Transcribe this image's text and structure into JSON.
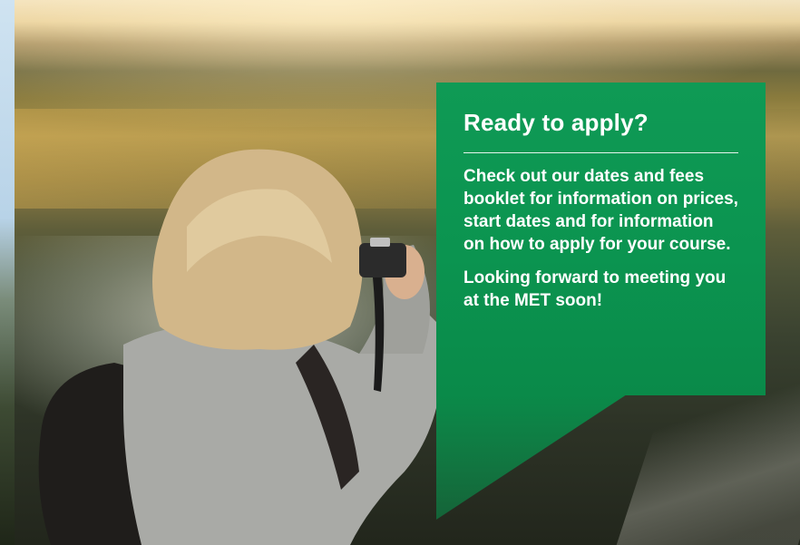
{
  "panel": {
    "title": "Ready to apply?",
    "body": "Check out our dates and fees booklet for information on prices, start dates and for information on how to apply for your course.",
    "closing": "Looking forward to meeting you at the MET soon!",
    "color": "#0b9450"
  },
  "photo": {
    "subject": "woman-photographing-landscape"
  }
}
